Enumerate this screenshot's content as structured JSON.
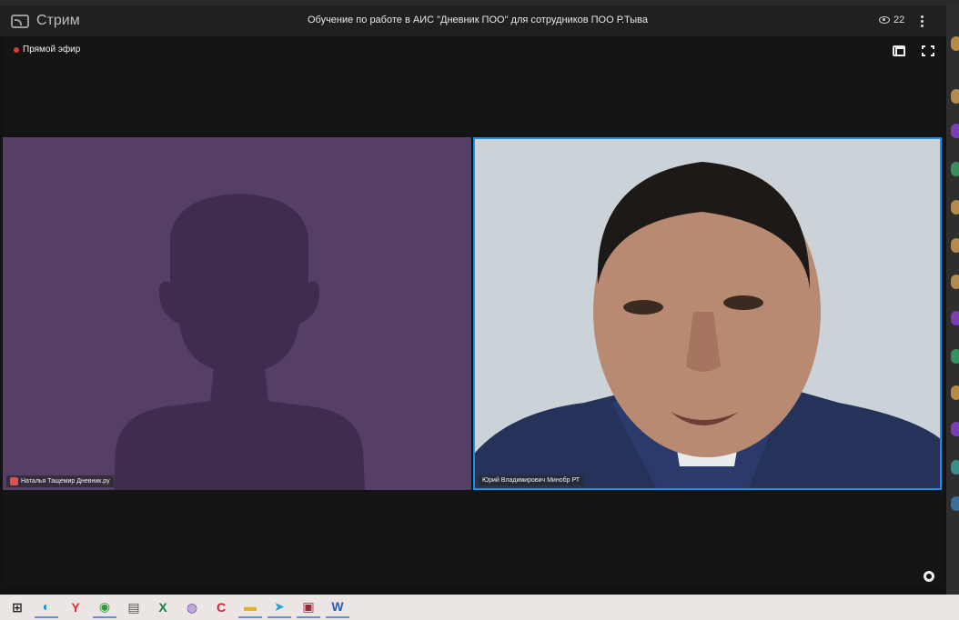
{
  "header": {
    "logo_label": "Стрим",
    "title": "Обучение по работе в АИС \"Дневник ПОО\" для сотрудников ПОО Р.Тыва",
    "viewer_count": "22"
  },
  "stage": {
    "live_label": "Прямой эфир",
    "tiles": [
      {
        "name": "Наталья Тащемир Дневник.ру"
      },
      {
        "name": "Юрий Владимирович Минобр РТ"
      }
    ]
  },
  "colors": {
    "accent": "#1e8fe8",
    "live": "#e53935",
    "placeholder_bg": "#563f67"
  },
  "taskbar": {
    "icons": [
      "windows-icon",
      "edge-icon",
      "yandex-icon",
      "chrome-icon",
      "printer-icon",
      "excel-icon",
      "viber-icon",
      "ccleaner-icon",
      "explorer-icon",
      "telegram-icon",
      "winrar-icon",
      "word-icon"
    ]
  }
}
